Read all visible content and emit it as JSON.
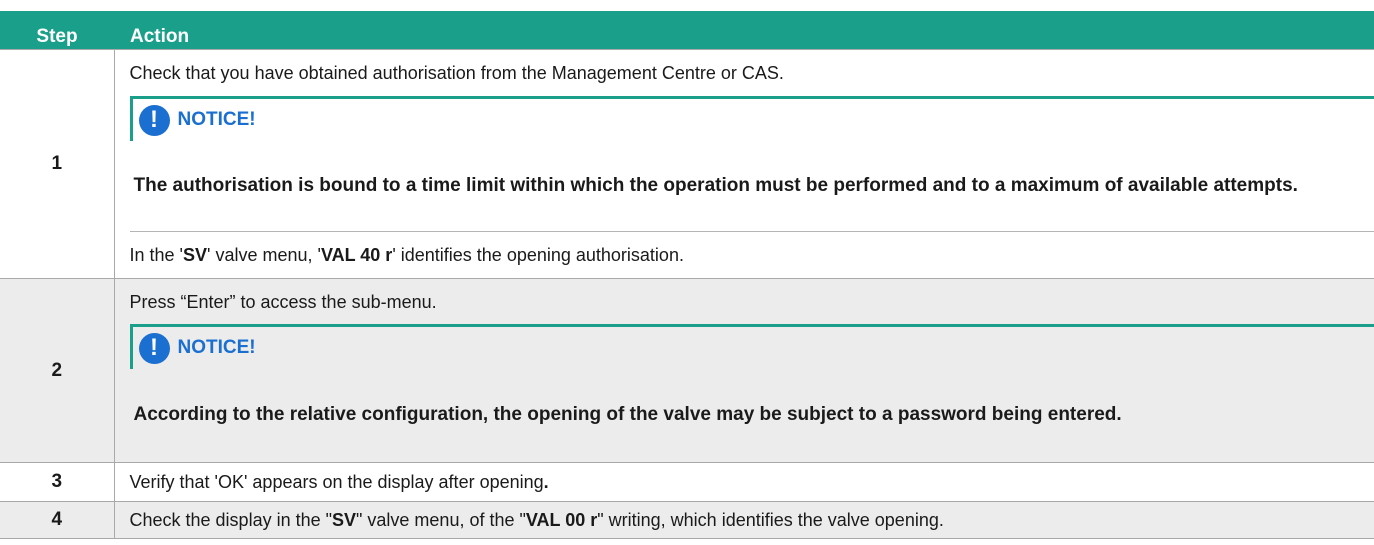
{
  "header": {
    "step_label": "Step",
    "action_label": "Action"
  },
  "rows": [
    {
      "number": "1",
      "text_before": "Check that you have obtained authorisation from the Management Centre or CAS.",
      "notice_title": "NOTICE!",
      "notice_text": "The authorisation is bound to a time limit within which the operation must be performed and to a maximum of available attempts.",
      "after": [
        "In the '",
        "SV",
        "' valve menu, '",
        "VAL 40 r",
        "' identifies the opening authorisation."
      ]
    },
    {
      "number": "2",
      "text_before": "Press “Enter” to access the sub-menu.",
      "notice_title": "NOTICE!",
      "notice_text": "According to the relative configuration, the opening of the valve may be subject to a password being entered."
    },
    {
      "number": "3",
      "text": [
        "Verify that 'OK' appears on the display after opening",
        "."
      ]
    },
    {
      "number": "4",
      "text": [
        "Check the display in the \"",
        "SV",
        "\" valve menu, of the \"",
        "VAL 00 r",
        "\" writing, which identifies the valve opening."
      ]
    }
  ],
  "colors": {
    "header_green": "#1aa08a",
    "notice_blue": "#1b6fd0",
    "shade": "#ececec"
  },
  "icons": {
    "notice": "exclamation-circle-icon"
  }
}
